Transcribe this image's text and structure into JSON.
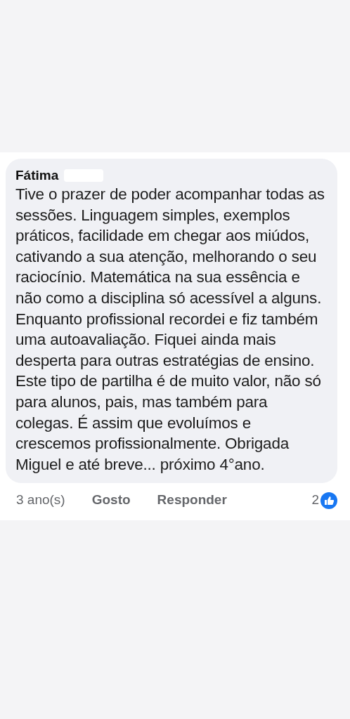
{
  "comment": {
    "author": "Fátima",
    "author_redacted": true,
    "text": "Tive o prazer de poder acompanhar todas as sessões. Linguagem simples, exemplos práticos, facilidade em chegar aos miúdos, cativando a sua atenção, melhorando o seu raciocínio. Matemática na sua essência e não como a disciplina só acessível a alguns. Enquanto profissional recordei e fiz também uma autoavaliação. Fiquei ainda mais desperta para outras estratégias de ensino. Este tipo de partilha é de muito valor, não só para alunos, pais, mas também para colegas. É assim que evoluímos e crescemos profissionalmente. Obrigada Miguel e até breve... próximo 4°ano.",
    "time": "3 ano(s)",
    "actions": [
      "Gosto",
      "Responder"
    ],
    "reaction_count": "2"
  }
}
